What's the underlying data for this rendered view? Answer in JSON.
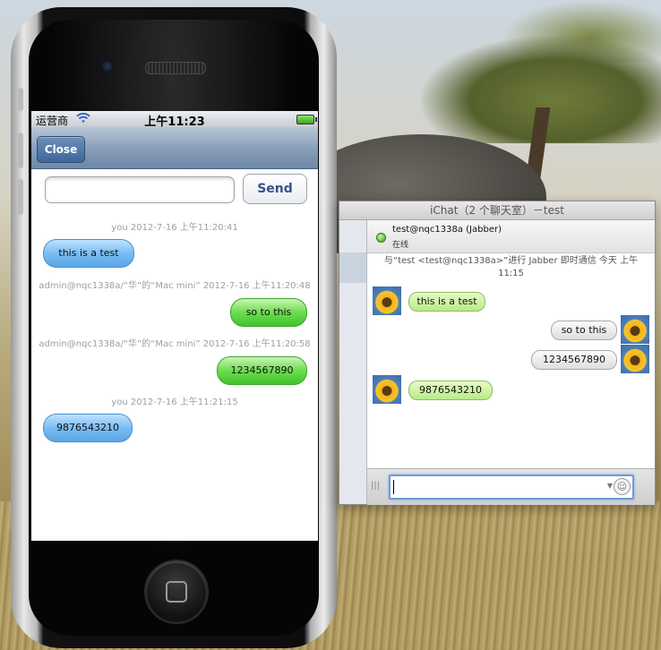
{
  "iphone": {
    "status": {
      "carrier": "运营商",
      "time": "上午11:23"
    },
    "nav": {
      "close_label": "Close"
    },
    "compose": {
      "input_value": "",
      "send_label": "Send"
    },
    "messages": [
      {
        "stamp": "you 2012-7-16 上午11:20:41",
        "text": "this is a test",
        "side": "left"
      },
      {
        "stamp": "admin@nqc1338a/“华”的“Mac mini” 2012-7-16 上午11:20:48",
        "text": "so to this",
        "side": "right"
      },
      {
        "stamp": "admin@nqc1338a/“华”的“Mac mini” 2012-7-16 上午11:20:58",
        "text": "1234567890",
        "side": "right"
      },
      {
        "stamp": "you 2012-7-16 上午11:21:15",
        "text": "9876543210",
        "side": "left"
      }
    ]
  },
  "ichat": {
    "title": "iChat（2 个聊天室）－test",
    "buddy_name": "test@nqc1338a (Jabber)",
    "buddy_status": "在线",
    "notice_line1": "与“test <test@nqc1338a>”进行 Jabber 即时通信   今天 上午",
    "notice_line2": "11:15",
    "messages": [
      {
        "text": "this is a test",
        "from": "buddy"
      },
      {
        "text": "so to this",
        "from": "me"
      },
      {
        "text": "1234567890",
        "from": "me"
      },
      {
        "text": "9876543210",
        "from": "buddy"
      }
    ],
    "input_value": ""
  },
  "colors": {
    "ios_bubble_blue": "#79bdf3",
    "ios_bubble_green": "#6cdd50",
    "ichat_bubble_green": "#b9ea86",
    "online_green": "#3aa10f"
  }
}
